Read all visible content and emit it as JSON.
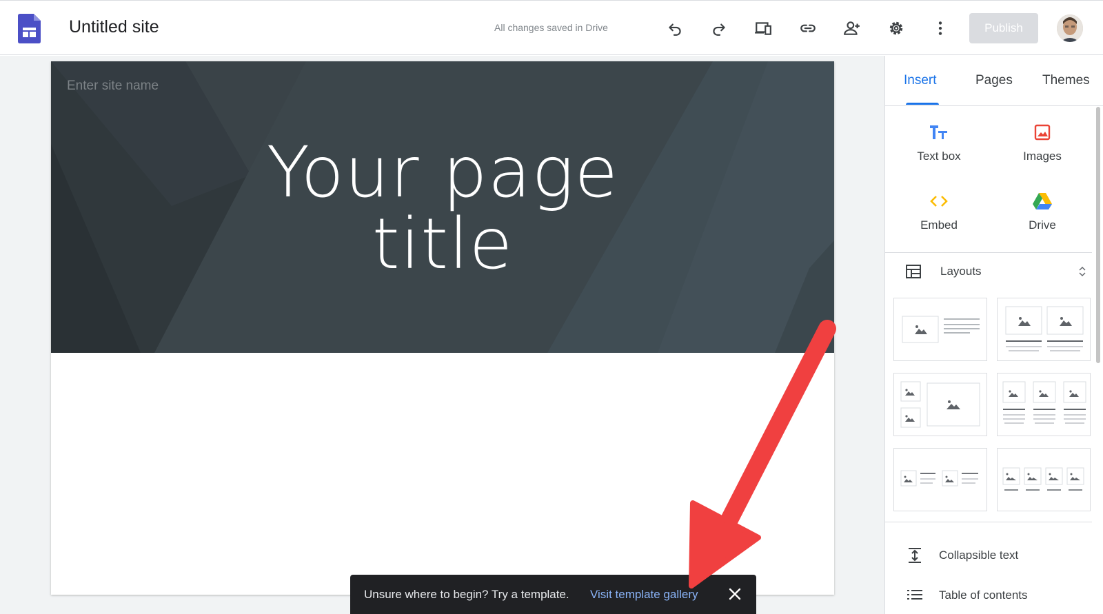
{
  "app": {
    "site_title": "Untitled site",
    "save_status": "All changes saved in Drive",
    "publish_label": "Publish"
  },
  "toolbar": {
    "icons": [
      "undo-icon",
      "redo-icon",
      "preview-icon",
      "link-icon",
      "share-icon",
      "settings-icon",
      "more-icon"
    ]
  },
  "page": {
    "site_name_placeholder": "Enter site name",
    "title_line1": "Your page",
    "title_line2": "title"
  },
  "panel": {
    "tabs": [
      {
        "label": "Insert",
        "active": true
      },
      {
        "label": "Pages",
        "active": false
      },
      {
        "label": "Themes",
        "active": false
      }
    ],
    "insert_items": [
      {
        "label": "Text box",
        "icon": "text-box-icon",
        "color": "#4285f4"
      },
      {
        "label": "Images",
        "icon": "images-icon",
        "color": "#ea4335"
      },
      {
        "label": "Embed",
        "icon": "embed-icon",
        "color": "#fbbc04"
      },
      {
        "label": "Drive",
        "icon": "drive-icon",
        "color": "#34a853"
      }
    ],
    "layouts_label": "Layouts",
    "extra_items": [
      {
        "label": "Collapsible text",
        "icon": "collapsible-text-icon"
      },
      {
        "label": "Table of contents",
        "icon": "table-of-contents-icon"
      }
    ]
  },
  "snackbar": {
    "message": "Unsure where to begin? Try a template.",
    "action": "Visit template gallery"
  },
  "colors": {
    "accent": "#1a73e8",
    "banner": "#3a4348",
    "arrow": "#f04040",
    "snackbar": "#202124"
  }
}
